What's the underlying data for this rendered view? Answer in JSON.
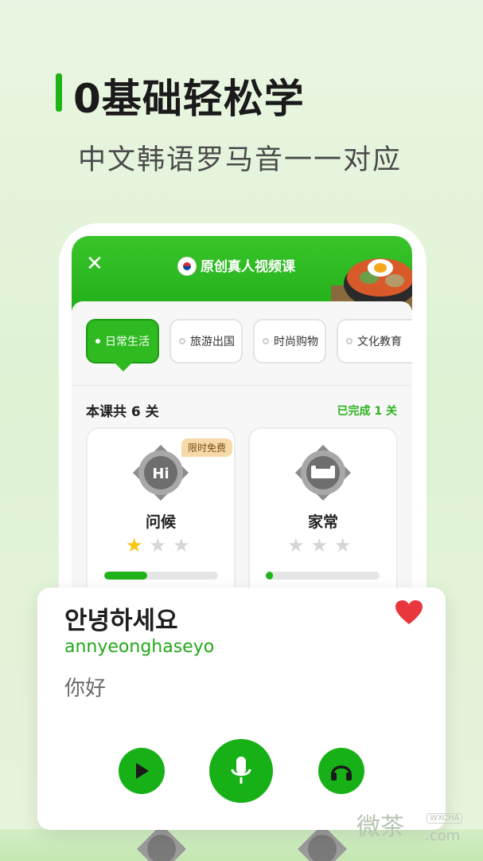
{
  "hero": {
    "title": "0基础轻松学",
    "subtitle": "中文韩语罗马音一一对应"
  },
  "header": {
    "close_icon": "✕",
    "title": "原创真人视频课",
    "flag_icon": "korea-flag-icon"
  },
  "categories": [
    {
      "label": "日常生活",
      "active": true
    },
    {
      "label": "旅游出国",
      "active": false
    },
    {
      "label": "时尚购物",
      "active": false
    },
    {
      "label": "文化教育",
      "active": false
    }
  ],
  "course": {
    "count_text": "本课共 6 关",
    "done_text": "已完成 1 关"
  },
  "lessons": [
    {
      "label": "问候",
      "badge": "限时免费",
      "stars_filled": 1,
      "stars_total": 3,
      "progress": 0.38,
      "icon": "hi-medal-icon"
    },
    {
      "label": "家常",
      "badge": "",
      "stars_filled": 0,
      "stars_total": 3,
      "progress": 0.06,
      "icon": "sofa-medal-icon"
    }
  ],
  "phrase": {
    "korean": "안녕하세요",
    "romanization": "annyeonghaseyo",
    "chinese": "你好"
  },
  "controls": {
    "play_icon": "play-icon",
    "mic_icon": "microphone-icon",
    "listen_icon": "headphones-icon"
  },
  "watermark": {
    "text": "微茶",
    "domain": ".com",
    "badge": "WXCHA"
  },
  "colors": {
    "brand_green": "#2fba22",
    "heart_red": "#e8373d",
    "star_yellow": "#f7c611"
  }
}
